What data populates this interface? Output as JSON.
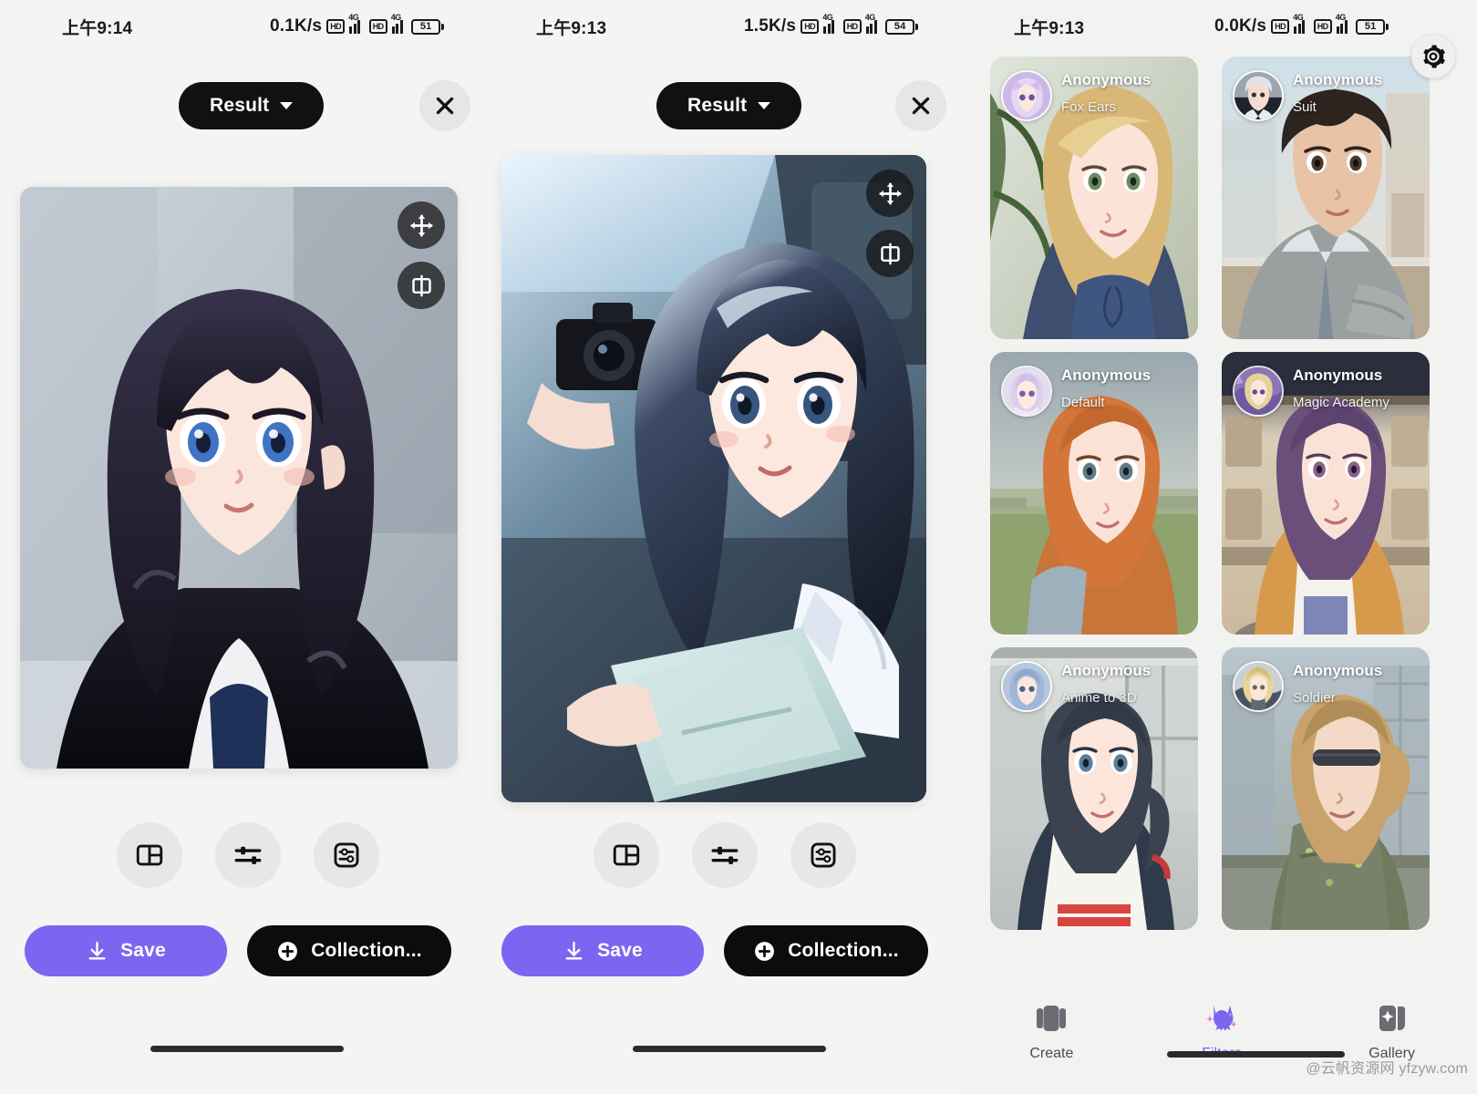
{
  "app": {
    "background": "#f4f4f3",
    "accent": "#7a66f0",
    "dark": "#111111"
  },
  "panels": [
    {
      "id": "panel-a",
      "status_bar": {
        "time": "上午9:14",
        "net_speed": "0.1K/s",
        "hd_badge": "HD",
        "network": "4G",
        "battery": "51"
      },
      "top_bar": {
        "result_label": "Result",
        "close_icon": "close-icon"
      },
      "image_overlay": {
        "move_icon": "move-icon",
        "compare_icon": "compare-split-icon"
      },
      "tools": [
        {
          "name": "layout-icon",
          "label": "Layout"
        },
        {
          "name": "adjust-sliders-icon",
          "label": "Adjust"
        },
        {
          "name": "parameters-icon",
          "label": "Parameters"
        }
      ],
      "actions": {
        "save_label": "Save",
        "save_icon": "download-icon",
        "collection_label": "Collection...",
        "collection_icon": "plus-circle-icon"
      }
    },
    {
      "id": "panel-b",
      "status_bar": {
        "time": "上午9:13",
        "net_speed": "1.5K/s",
        "hd_badge": "HD",
        "network": "4G",
        "battery": "54"
      },
      "top_bar": {
        "result_label": "Result",
        "close_icon": "close-icon"
      },
      "image_overlay": {
        "move_icon": "move-icon",
        "compare_icon": "compare-split-icon"
      },
      "tools": [
        {
          "name": "layout-icon",
          "label": "Layout"
        },
        {
          "name": "adjust-sliders-icon",
          "label": "Adjust"
        },
        {
          "name": "parameters-icon",
          "label": "Parameters"
        }
      ],
      "actions": {
        "save_label": "Save",
        "save_icon": "download-icon",
        "collection_label": "Collection...",
        "collection_icon": "plus-circle-icon"
      }
    },
    {
      "id": "panel-c",
      "status_bar": {
        "time": "上午9:13",
        "net_speed": "0.0K/s",
        "hd_badge": "HD",
        "network": "4G",
        "battery": "51"
      },
      "gear_icon": "gear-icon"
    }
  ],
  "filter_cards": [
    {
      "user": "Anonymous",
      "tag": "Fox Ears"
    },
    {
      "user": "Anonymous",
      "tag": "Suit"
    },
    {
      "user": "Anonymous",
      "tag": "Default"
    },
    {
      "user": "Anonymous",
      "tag": "Magic Academy"
    },
    {
      "user": "Anonymous",
      "tag": "Anime to 3D"
    },
    {
      "user": "Anonymous",
      "tag": "Soldier"
    }
  ],
  "bottom_nav": {
    "items": [
      {
        "label": "Create",
        "icon": "cards-stack-icon",
        "active": false
      },
      {
        "label": "Filters",
        "icon": "cat-sparkle-icon",
        "active": true
      },
      {
        "label": "Gallery",
        "icon": "gallery-sparkle-icon",
        "active": false
      }
    ]
  },
  "watermark": "@云帆资源网 yfzyw.com"
}
